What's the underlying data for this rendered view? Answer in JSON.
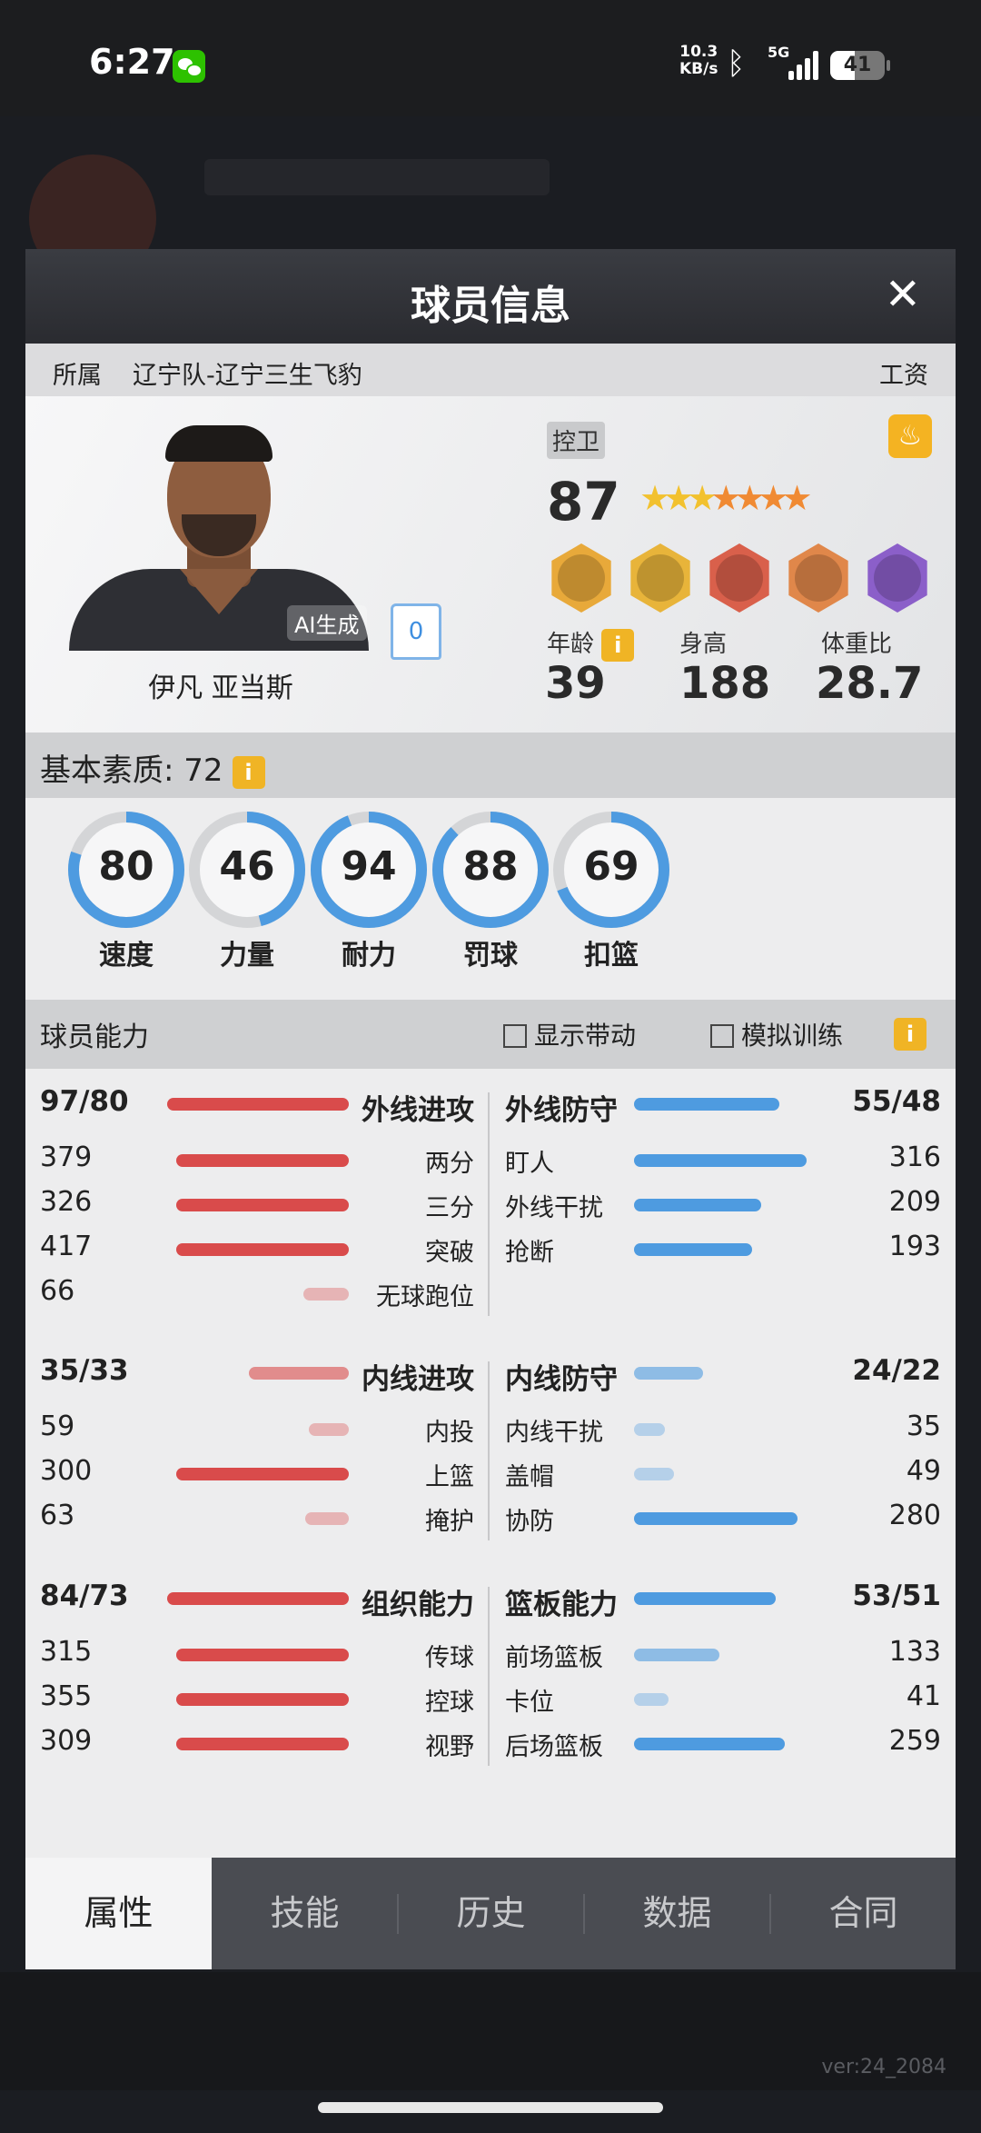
{
  "status_bar": {
    "time": "6:27",
    "speed_value": "10.3",
    "speed_unit": "KB/s",
    "network": "5G",
    "battery": "41"
  },
  "modal": {
    "title": "球员信息",
    "close": "✕"
  },
  "affiliation": {
    "label": "所属",
    "team": "辽宁队-辽宁三生飞豹",
    "salary_label": "工资"
  },
  "player": {
    "name": "伊凡 亚当斯",
    "ai_badge": "AI生成",
    "jersey_number": "0",
    "position": "控卫",
    "overall": "87",
    "stars": {
      "total": 7,
      "gold": 3
    },
    "badges": [
      "inside-scorer-badge",
      "speed-badge",
      "defense-badge",
      "three-point-badge",
      "playmaker-badge"
    ],
    "age_label": "年龄",
    "age": "39",
    "height_label": "身高",
    "height": "188",
    "weight_ratio_label": "体重比",
    "weight_ratio": "28.7",
    "fire_icon": "fire-icon"
  },
  "basic": {
    "title": "基本素质: 72",
    "info": "i",
    "gauges": [
      {
        "label": "速度",
        "value": 80
      },
      {
        "label": "力量",
        "value": 46
      },
      {
        "label": "耐力",
        "value": 94
      },
      {
        "label": "罚球",
        "value": 88
      },
      {
        "label": "扣篮",
        "value": 69
      }
    ]
  },
  "abilities": {
    "title": "球员能力",
    "show_boost": "显示带动",
    "sim_training": "模拟训练",
    "info": "i",
    "groups": [
      {
        "left": {
          "name": "外线进攻",
          "value": "97/80",
          "level": 1.0,
          "items": [
            {
              "name": "两分",
              "value": "379",
              "level": 0.95
            },
            {
              "name": "三分",
              "value": "326",
              "level": 0.95
            },
            {
              "name": "突破",
              "value": "417",
              "level": 0.95
            },
            {
              "name": "无球跑位",
              "value": "66",
              "level": 0.25
            }
          ]
        },
        "right": {
          "name": "外线防守",
          "value": "55/48",
          "level": 0.8,
          "items": [
            {
              "name": "盯人",
              "value": "316",
              "level": 0.95
            },
            {
              "name": "外线干扰",
              "value": "209",
              "level": 0.7
            },
            {
              "name": "抢断",
              "value": "193",
              "level": 0.65
            }
          ]
        }
      },
      {
        "left": {
          "name": "内线进攻",
          "value": "35/33",
          "level": 0.55,
          "items": [
            {
              "name": "内投",
              "value": "59",
              "level": 0.22
            },
            {
              "name": "上篮",
              "value": "300",
              "level": 0.95
            },
            {
              "name": "掩护",
              "value": "63",
              "level": 0.24
            }
          ]
        },
        "right": {
          "name": "内线防守",
          "value": "24/22",
          "level": 0.38,
          "items": [
            {
              "name": "内线干扰",
              "value": "35",
              "level": 0.17
            },
            {
              "name": "盖帽",
              "value": "49",
              "level": 0.22
            },
            {
              "name": "协防",
              "value": "280",
              "level": 0.9
            }
          ]
        }
      },
      {
        "left": {
          "name": "组织能力",
          "value": "84/73",
          "level": 1.0,
          "items": [
            {
              "name": "传球",
              "value": "315",
              "level": 0.95
            },
            {
              "name": "控球",
              "value": "355",
              "level": 0.95
            },
            {
              "name": "视野",
              "value": "309",
              "level": 0.95
            }
          ]
        },
        "right": {
          "name": "篮板能力",
          "value": "53/51",
          "level": 0.78,
          "items": [
            {
              "name": "前场篮板",
              "value": "133",
              "level": 0.47
            },
            {
              "name": "卡位",
              "value": "41",
              "level": 0.19
            },
            {
              "name": "后场篮板",
              "value": "259",
              "level": 0.83
            }
          ]
        }
      }
    ]
  },
  "tabs": [
    "属性",
    "技能",
    "历史",
    "数据",
    "合同"
  ],
  "active_tab": 0,
  "version": "ver:24_2084",
  "colors": {
    "red": "#d94b4b",
    "blue": "#4e9be0",
    "gold_star": "#f2c12e",
    "orange_star": "#f08a33",
    "accent": "#f0b425"
  }
}
